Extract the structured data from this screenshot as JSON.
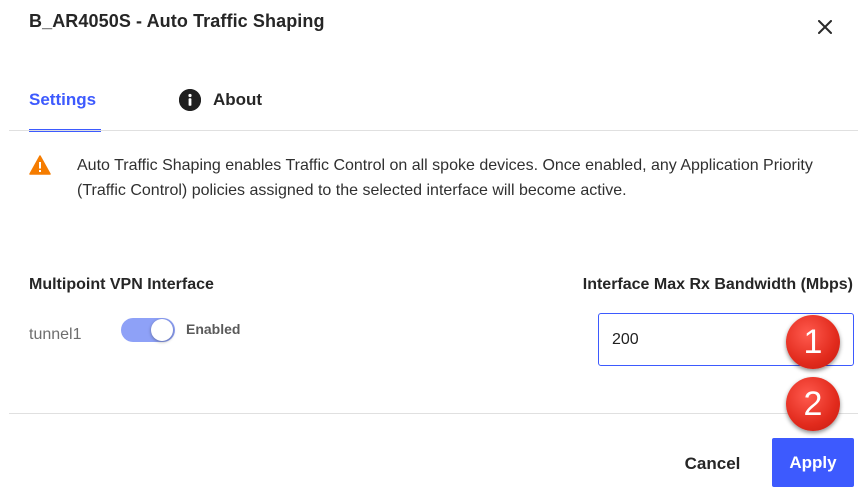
{
  "dialog": {
    "title": "B_AR4050S - Auto Traffic Shaping",
    "close_icon": "close-icon"
  },
  "tabs": [
    {
      "label": "Settings",
      "active": true
    },
    {
      "label": "About",
      "icon": "info-icon",
      "active": false
    }
  ],
  "alert": {
    "icon": "warning-icon",
    "text": "Auto Traffic Shaping enables Traffic Control on all spoke devices. Once enabled, any Application Priority (Traffic Control) policies assigned to the selected interface will become active."
  },
  "form": {
    "vpn_label": "Multipoint VPN Interface",
    "bandwidth_label": "Interface Max Rx Bandwidth (Mbps)",
    "interface_name": "tunnel1",
    "toggle_state": "Enabled",
    "bandwidth_value": "200"
  },
  "footer": {
    "cancel_label": "Cancel",
    "apply_label": "Apply"
  },
  "annotations": {
    "step1": "1",
    "step2": "2"
  },
  "colors": {
    "accent": "#3d5afe",
    "warning": "#f57c00",
    "toggle_track": "#8ea1f7",
    "step_marker": "#e22b1d"
  }
}
